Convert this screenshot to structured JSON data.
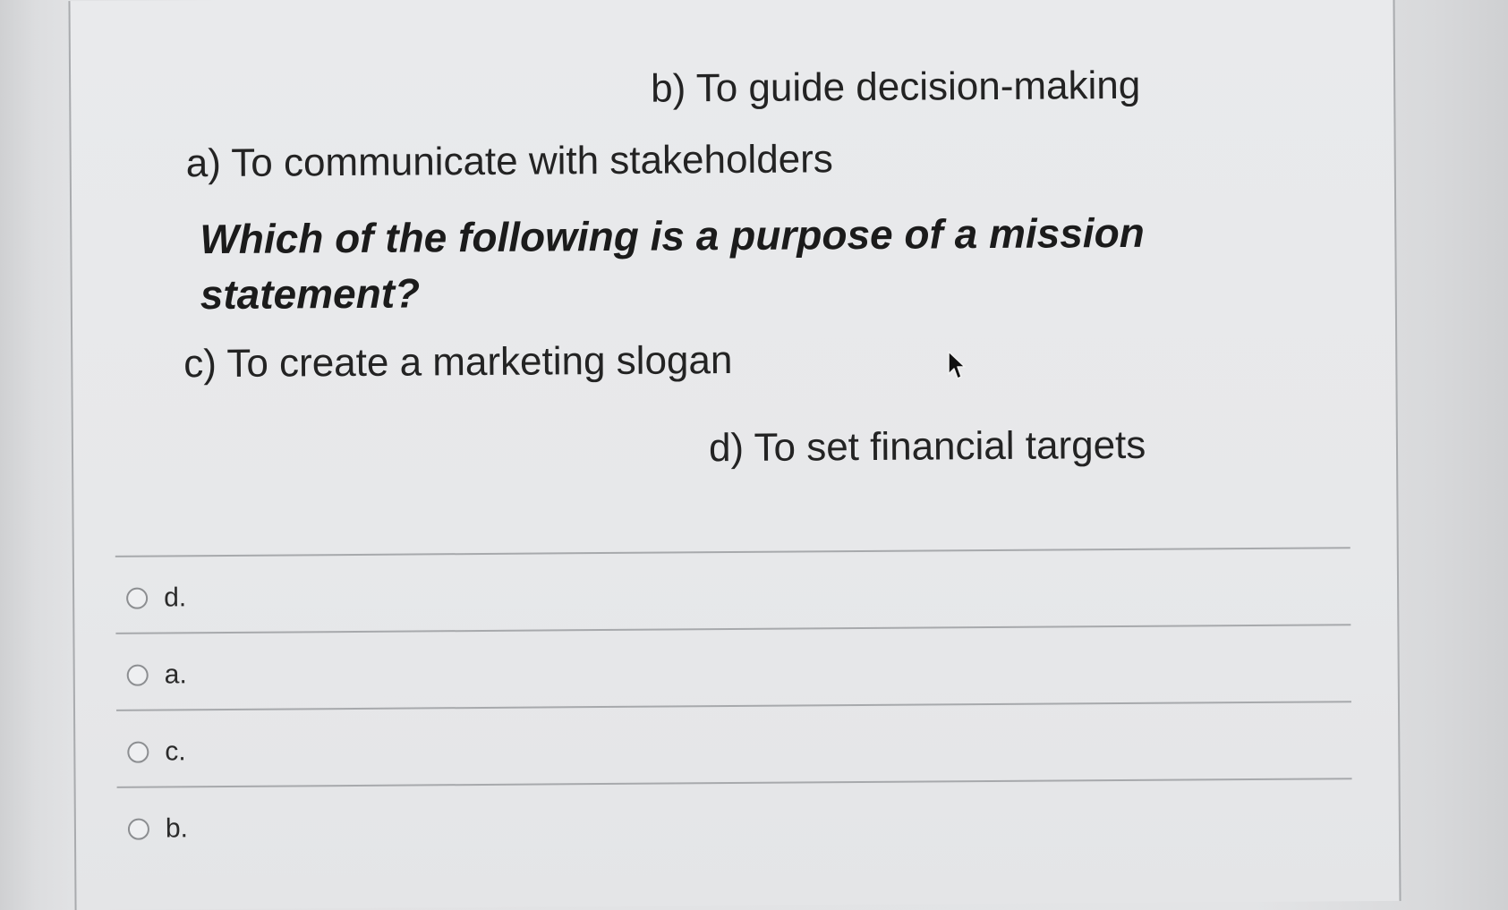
{
  "question": {
    "text": "Which of the following is a purpose of a mission statement?",
    "options": {
      "b": "b) To guide decision-making",
      "a": "a) To communicate with stakeholders",
      "c": "c) To create a marketing slogan",
      "d": "d) To set financial targets"
    }
  },
  "answers": [
    {
      "label": "d.",
      "selected": false
    },
    {
      "label": "a.",
      "selected": false
    },
    {
      "label": "c.",
      "selected": false
    },
    {
      "label": "b.",
      "selected": false
    }
  ]
}
